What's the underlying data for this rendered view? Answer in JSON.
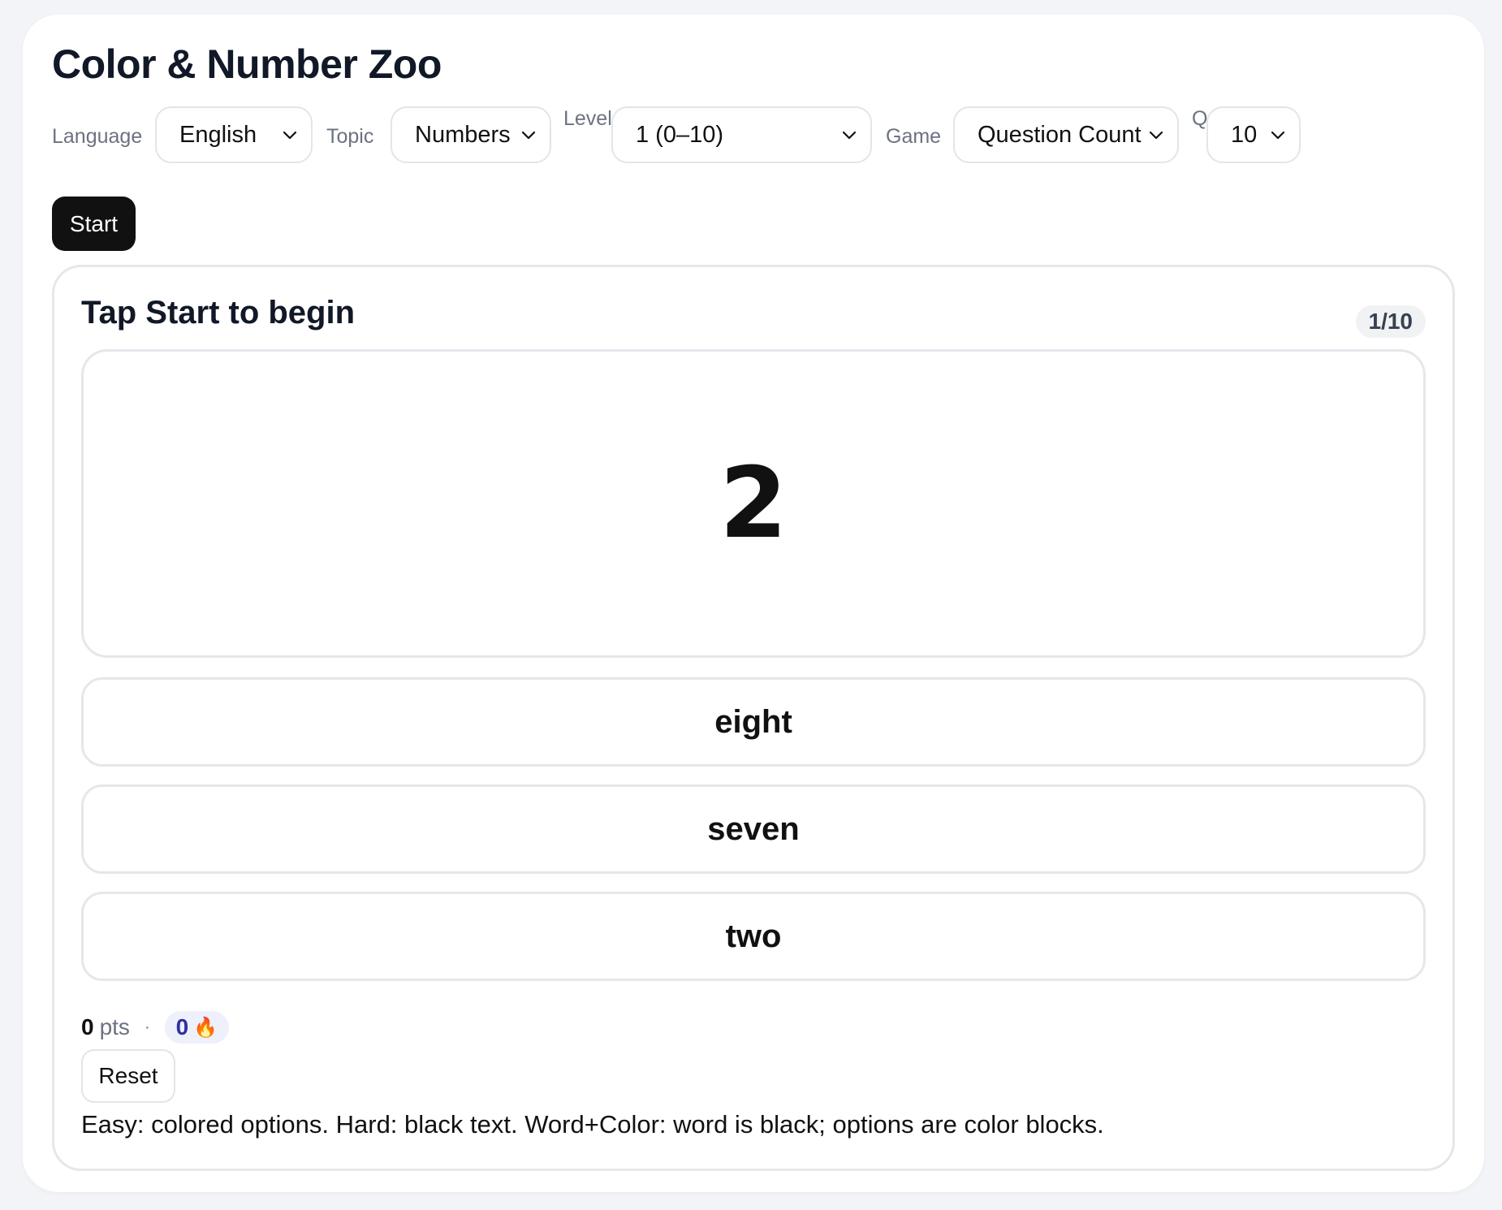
{
  "app": {
    "title": "Color & Number Zoo"
  },
  "controls": {
    "language": {
      "label": "Language",
      "value": "English"
    },
    "topic": {
      "label": "Topic",
      "value": "Numbers"
    },
    "level": {
      "label": "Level",
      "value": "1 (0–10)"
    },
    "game": {
      "label": "Game",
      "value": "Question Count"
    },
    "q": {
      "label": "Q",
      "value": "10"
    },
    "start_label": "Start"
  },
  "panel": {
    "prompt": "Tap Start to begin",
    "progress": "1/10",
    "stimulus": "2",
    "options": [
      "eight",
      "seven",
      "two"
    ],
    "score": {
      "points": "0",
      "unit": "pts",
      "separator": "·",
      "streak": "0",
      "streak_icon": "🔥"
    },
    "reset_label": "Reset",
    "help": "Easy: colored options. Hard: black text. Word+Color: word is black; options are color blocks."
  }
}
